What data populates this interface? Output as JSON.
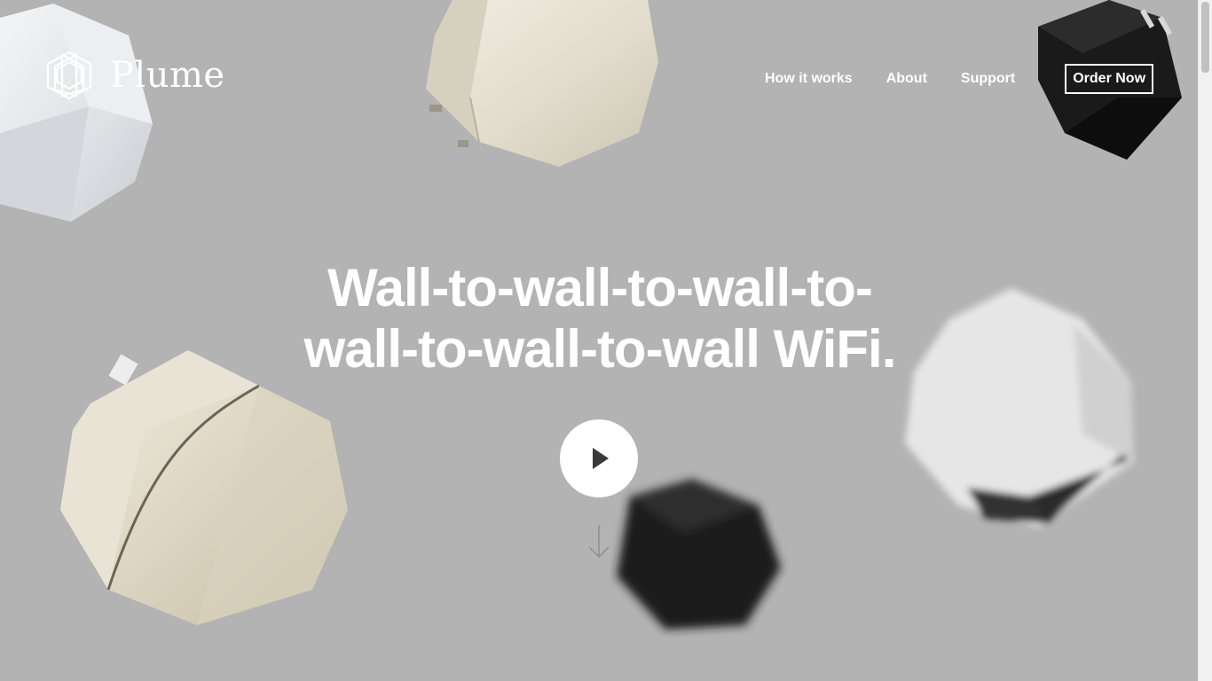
{
  "brand": {
    "name": "Plume",
    "text_color": "#ffffff"
  },
  "nav": {
    "items": [
      {
        "label": "How it works"
      },
      {
        "label": "About"
      },
      {
        "label": "Support"
      }
    ],
    "cta_label": "Order Now"
  },
  "hero": {
    "title_line1": "Wall-to-wall-to-wall-to-",
    "title_line2": "wall-to-wall-to-wall WiFi.",
    "play_icon": "play-icon",
    "scroll_icon": "arrow-down-icon"
  },
  "colors": {
    "background": "#b3b3b3",
    "text": "#ffffff"
  }
}
